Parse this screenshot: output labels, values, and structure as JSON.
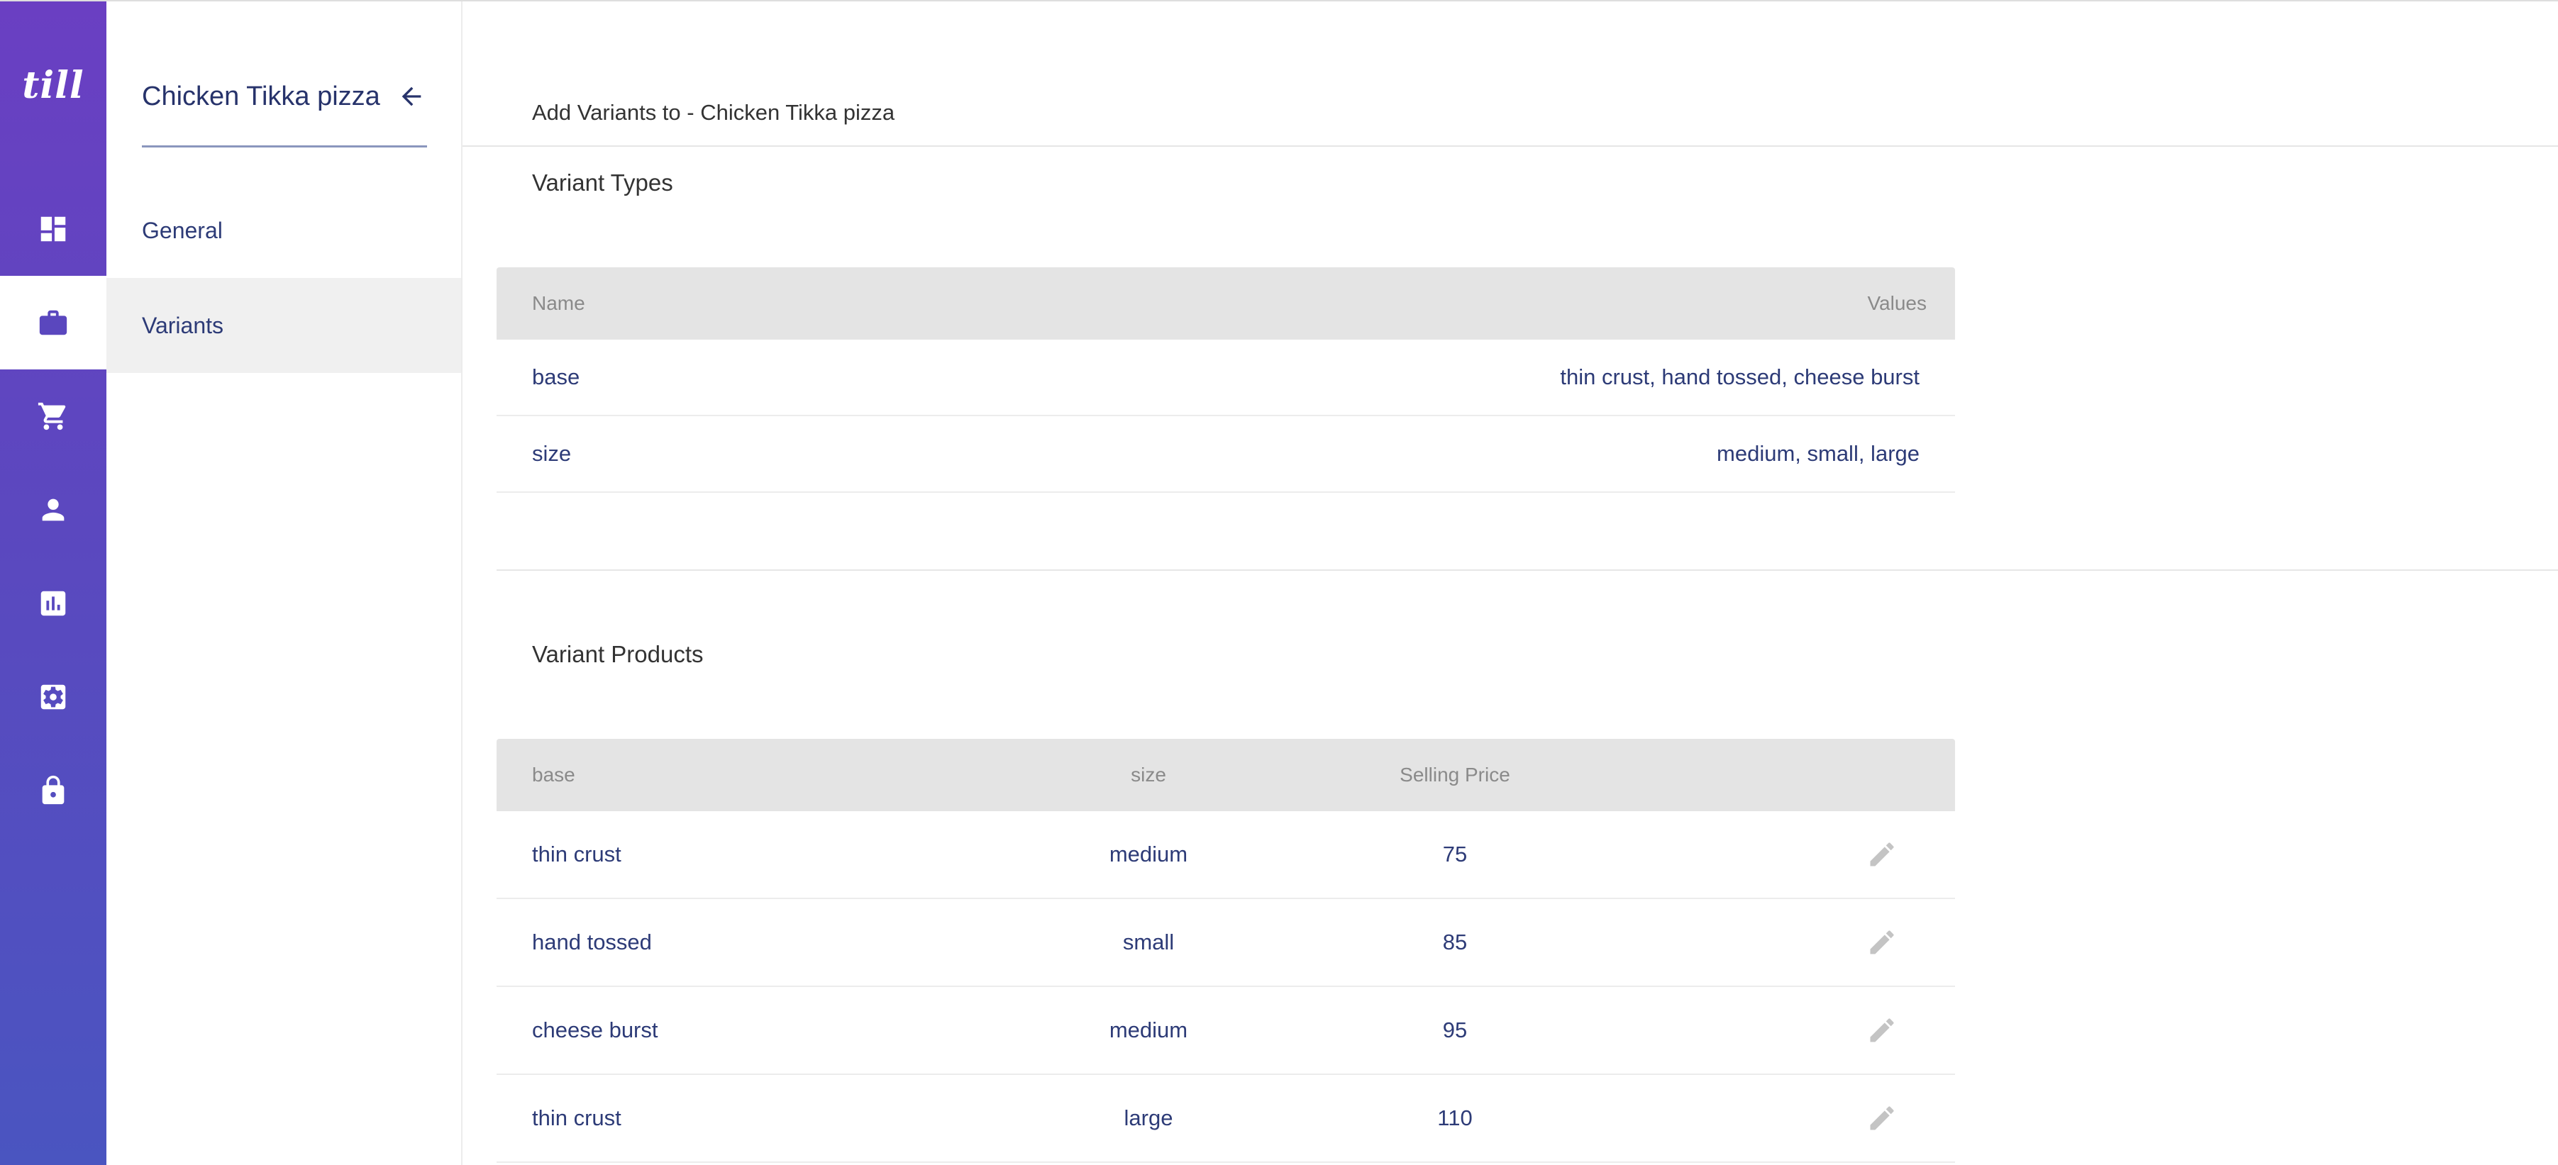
{
  "app": {
    "logo_text": "till",
    "colors": {
      "rail_top": "#6a3fc2",
      "rail_bottom": "#4a55c0",
      "accent_text": "#2d3b77"
    }
  },
  "rail": {
    "items": [
      {
        "icon": "dashboard-icon",
        "active": false
      },
      {
        "icon": "briefcase-icon",
        "active": true
      },
      {
        "icon": "cart-icon",
        "active": false
      },
      {
        "icon": "person-icon",
        "active": false
      },
      {
        "icon": "bar-chart-icon",
        "active": false
      },
      {
        "icon": "settings-icon",
        "active": false
      },
      {
        "icon": "lock-icon",
        "active": false
      }
    ]
  },
  "subnav": {
    "title": "Chicken Tikka pizza",
    "back_icon": "arrow-left-icon",
    "items": [
      {
        "label": "General",
        "active": false
      },
      {
        "label": "Variants",
        "active": true
      }
    ]
  },
  "main": {
    "heading": "Add Variants to - Chicken Tikka pizza",
    "variant_types": {
      "title": "Variant Types",
      "columns": [
        "Name",
        "Values"
      ],
      "rows": [
        {
          "name": "base",
          "values": "thin crust, hand tossed, cheese burst"
        },
        {
          "name": "size",
          "values": "medium, small, large"
        }
      ]
    },
    "variant_products": {
      "title": "Variant Products",
      "columns": [
        "base",
        "size",
        "Selling Price"
      ],
      "edit_icon": "pencil-icon",
      "rows": [
        {
          "base": "thin crust",
          "size": "medium",
          "price": "75"
        },
        {
          "base": "hand tossed",
          "size": "small",
          "price": "85"
        },
        {
          "base": "cheese burst",
          "size": "medium",
          "price": "95"
        },
        {
          "base": "thin crust",
          "size": "large",
          "price": "110"
        }
      ]
    }
  }
}
